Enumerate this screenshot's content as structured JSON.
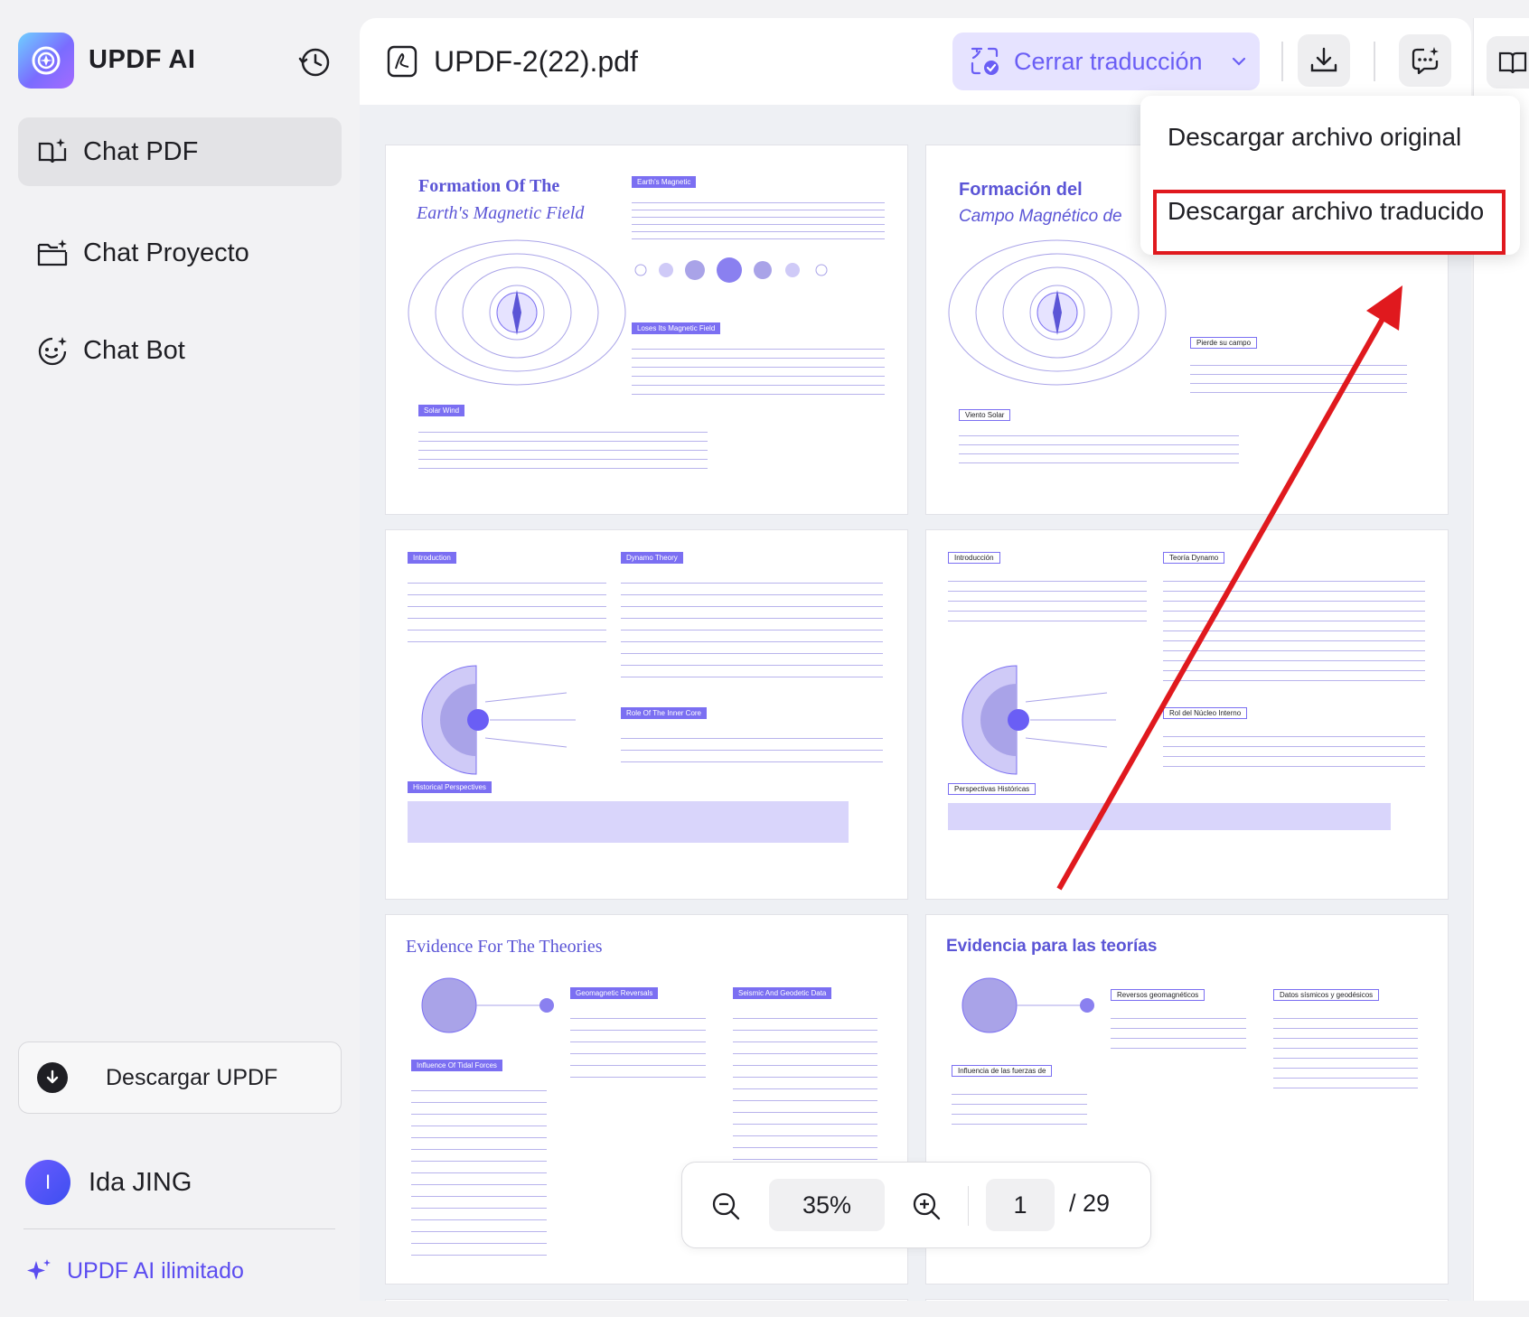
{
  "app": {
    "title": "UPDF AI"
  },
  "sidebar": {
    "items": [
      {
        "label": "Chat PDF",
        "icon": "book-ai-icon",
        "active": true
      },
      {
        "label": "Chat Proyecto",
        "icon": "folder-ai-icon",
        "active": false
      },
      {
        "label": "Chat Bot",
        "icon": "bot-face-icon",
        "active": false
      }
    ],
    "download_label": "Descargar UPDF",
    "user": {
      "initial": "I",
      "name": "Ida JING"
    },
    "unlimited_label": "UPDF AI ilimitado"
  },
  "header": {
    "file_name": "UPDF-2(22).pdf",
    "translate_label": "Cerrar traducción"
  },
  "dropdown": {
    "items": [
      "Descargar archivo original",
      "Descargar archivo traducido"
    ],
    "highlighted_index": 1
  },
  "zoom": {
    "level": "35%",
    "current_page": "1",
    "total_pages": "/ 29"
  },
  "pages": {
    "p1_title_1": "Formation Of The",
    "p1_title_2": "Earth's Magnetic Field",
    "p1_tag_1": "Earth's Magnetic",
    "p1_tag_2": "Loses Its Magnetic Field",
    "p1_tag_3": "Solar Wind",
    "p2_title_1": "Formación del",
    "p2_title_2": "Campo Magnético de",
    "p2_tag_1": "Pierde su campo",
    "p2_tag_2": "Viento Solar",
    "p3_tag_1": "Introduction",
    "p3_tag_2": "Dynamo Theory",
    "p3_tag_3": "Role Of The Inner Core",
    "p3_tag_4": "Historical Perspectives",
    "p4_tag_1": "Introducción",
    "p4_tag_2": "Teoría Dynamo",
    "p4_tag_3": "Rol del Núcleo Interno",
    "p4_tag_4": "Perspectivas Históricas",
    "p5_title": "Evidence For The Theories",
    "p5_tag_1": "Geomagnetic Reversals",
    "p5_tag_2": "Seismic And Geodetic Data",
    "p5_tag_3": "Influence Of Tidal Forces",
    "p6_title": "Evidencia para las teorías",
    "p6_tag_1": "Reversos geomagnéticos",
    "p6_tag_2": "Datos sísmicos y geodésicos",
    "p6_tag_3": "Influencia de las fuerzas de"
  },
  "colors": {
    "accent": "#6a5ef5",
    "accent_bg": "#e6e3ff",
    "highlight": "#e0191e",
    "page_purple": "#7b6ff2"
  }
}
